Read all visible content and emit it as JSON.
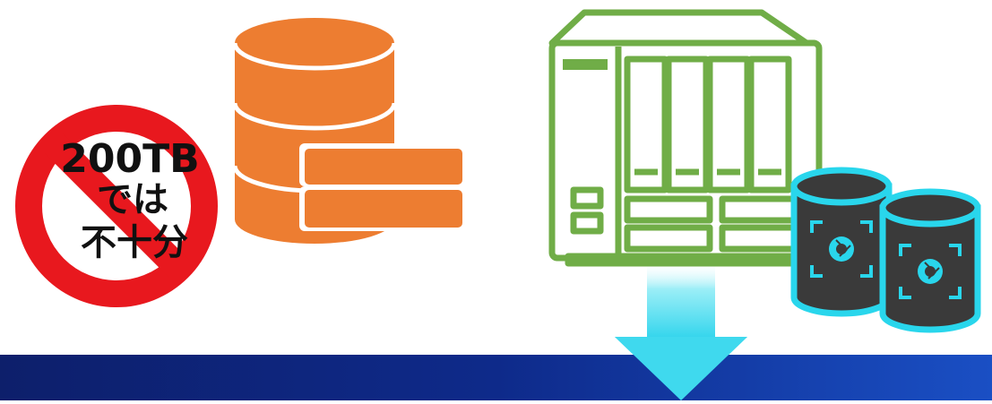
{
  "no_entry_label": {
    "line1": "200TB",
    "line2": "では",
    "line3": "不十分"
  },
  "colors": {
    "prohibition_red": "#e8181e",
    "database_orange": "#ed7d31",
    "nas_green": "#70ad47",
    "snapshot_cyan": "#29d6ec",
    "snapshot_dark": "#3a3a3a",
    "arrow_cyan": "#3fd9ee",
    "footer_blue": "#0e2a8a"
  },
  "icons": {
    "prohibition": "no-entry-sign",
    "database": "database-cylinder",
    "expansion": "storage-drawer",
    "nas": "nas-device",
    "snapshot": "camera-aperture",
    "arrow": "down-arrow"
  }
}
